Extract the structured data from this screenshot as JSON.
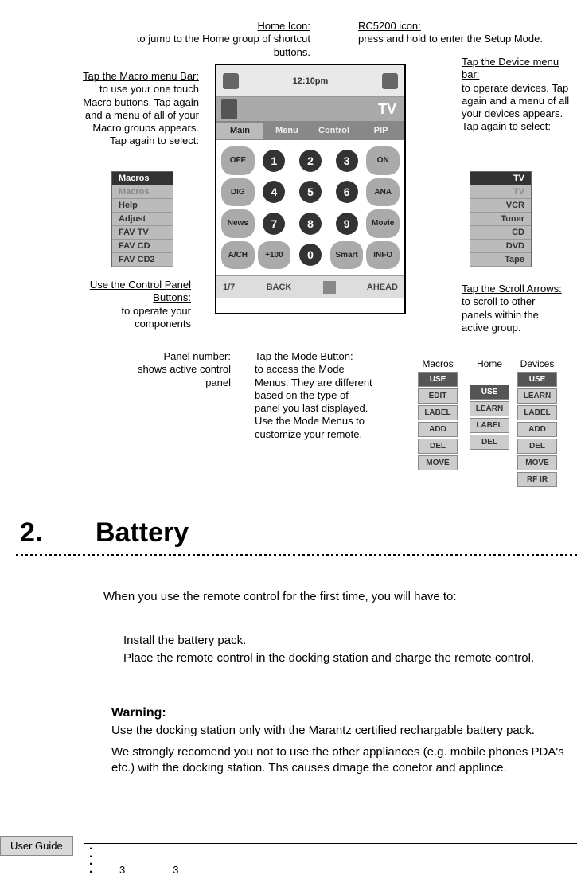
{
  "callouts": {
    "home_icon_title": "Home Icon:",
    "home_icon_text": "to jump to the Home group of shortcut buttons.",
    "rc5200_title": "RC5200  icon:",
    "rc5200_text": "press and hold to enter the Setup Mode.",
    "macro_bar_title": "Tap the Macro menu Bar:",
    "macro_bar_text": "to use your one touch Macro buttons. Tap again and a menu of all of your Macro groups appears. Tap again to select:",
    "device_bar_title": "Tap the Device menu bar:",
    "device_bar_text": "to operate devices. Tap again and a menu of all your devices appears. Tap again to select:",
    "cpanel_title": "Use the Control Panel Buttons:",
    "cpanel_text": "to operate your components",
    "scroll_title": "Tap the Scroll Arrows:",
    "scroll_text": "to scroll to other panels within the active group.",
    "panelnum_title": "Panel number:",
    "panelnum_text": "shows active control panel",
    "modebtn_title": "Tap the Mode Button:",
    "modebtn_text": "to access the Mode Menus. They are different based on the type of panel you last displayed. Use the Mode Menus to customize your remote."
  },
  "device": {
    "time": "12:10pm",
    "title": "TV",
    "tabs": [
      "Main",
      "Menu",
      "Control",
      "PIP"
    ],
    "keys_row1": [
      "OFF",
      "1",
      "2",
      "3",
      "ON"
    ],
    "keys_row2": [
      "DIG",
      "4",
      "5",
      "6",
      "ANA"
    ],
    "keys_row3": [
      "News",
      "7",
      "8",
      "9",
      "Movie"
    ],
    "keys_row4": [
      "A/CH",
      "+100",
      "0",
      "Smart",
      "INFO"
    ],
    "bottom_left": "1/7",
    "bottom_back": "BACK",
    "bottom_ahead": "AHEAD"
  },
  "macro_menu": [
    "Macros",
    "Macros",
    "Help",
    "Adjust",
    "FAV TV",
    "FAV CD",
    "FAV CD2"
  ],
  "device_menu": [
    "TV",
    "TV",
    "VCR",
    "Tuner",
    "CD",
    "DVD",
    "Tape"
  ],
  "mode_labels": {
    "macros": "Macros",
    "home": "Home",
    "devices": "Devices"
  },
  "mode_macros": [
    "USE",
    "EDIT",
    "LABEL",
    "ADD",
    "DEL",
    "MOVE"
  ],
  "mode_home": [
    "USE",
    "LEARN",
    "LABEL",
    "DEL"
  ],
  "mode_devices": [
    "USE",
    "LEARN",
    "LABEL",
    "ADD",
    "DEL",
    "MOVE",
    "RF  IR"
  ],
  "section": {
    "num": "2.",
    "title": "Battery",
    "intro": "When you use the remote control for the first time, you will have to:",
    "step1": "Install the battery pack.",
    "step2": "Place the remote control in the docking station and charge the remote control.",
    "warning_h": "Warning:",
    "warning1": "Use the docking station only with the Marantz certified rechargable battery pack.",
    "warning2": "We strongly recomend you not to use the other appliances (e.g. mobile phones PDA's etc.) with the docking station. Ths causes dmage the conetor and applince."
  },
  "footer": {
    "tab": "User Guide",
    "n1": "3",
    "n2": "3"
  }
}
